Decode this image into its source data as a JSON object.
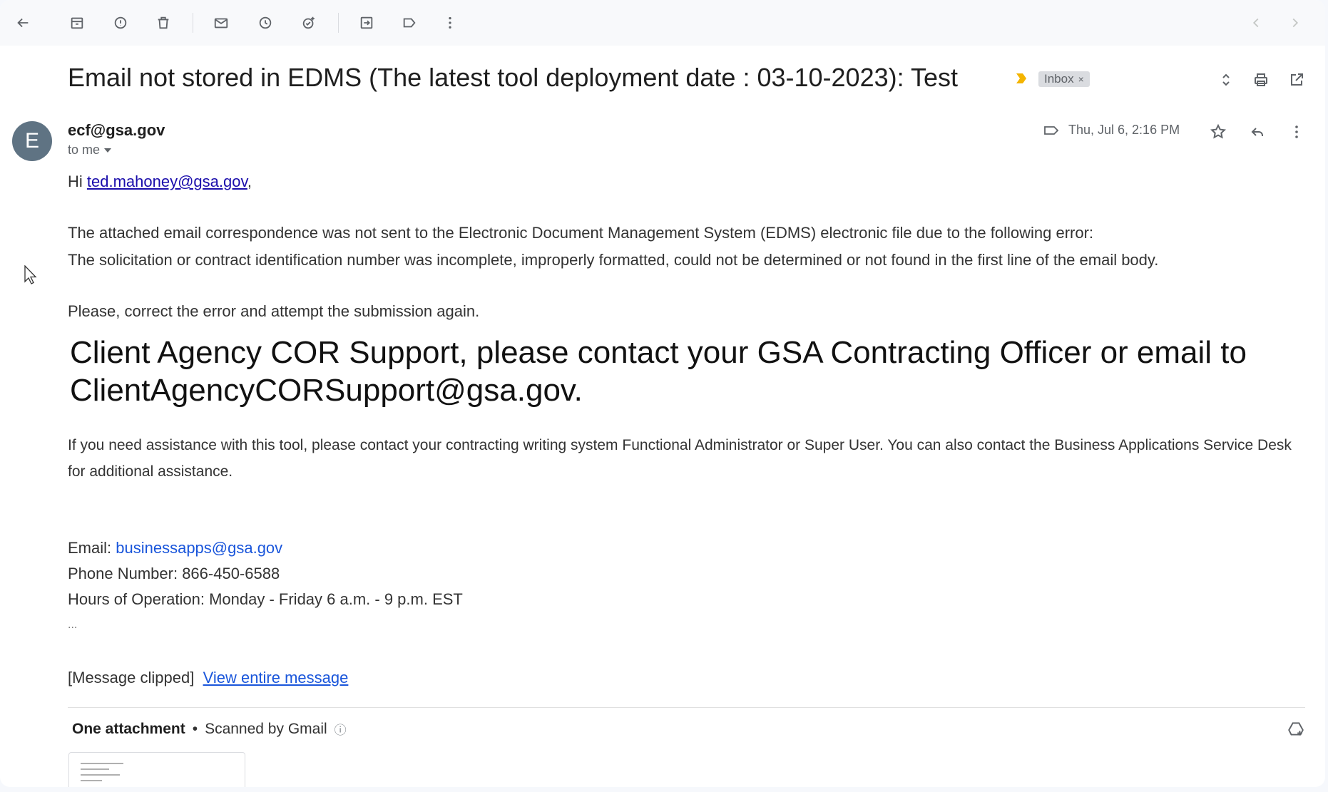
{
  "toolbar": {
    "buttons": [
      "back-icon",
      "archive-icon",
      "report-spam-icon",
      "delete-icon",
      "mark-unread-icon",
      "snooze-icon",
      "add-task-icon",
      "move-to-icon",
      "labels-icon",
      "more-icon"
    ],
    "nav": [
      "older-icon",
      "newer-icon"
    ]
  },
  "subject": {
    "text": "Email not stored in EDMS (The latest tool deployment date : 03-10-2023): Test",
    "label": "Inbox",
    "label_close": "×",
    "importance_color": "#f4b400"
  },
  "message": {
    "avatar_letter": "E",
    "avatar_color": "#5f7383",
    "sender": "ecf@gsa.gov",
    "recipient": "to me",
    "date": "Thu, Jul 6, 2:16 PM"
  },
  "body": {
    "greeting_prefix": "Hi ",
    "greeting_link": "ted.mahoney@gsa.gov",
    "greeting_suffix": ",",
    "error_line1": "The attached email correspondence was not sent to the Electronic Document Management System (EDMS) electronic file due to the following error:",
    "error_line2": "The solicitation or contract identification number was incomplete, improperly formatted, could not be determined or not found in the first line of the email body.",
    "retry_line": "Please, correct the error and attempt the submission again.",
    "notice": "Client Agency COR Support, please contact your GSA Contracting Officer or email to ClientAgencyCORSupport@gsa.gov.",
    "assist_para": "If you need assistance with this tool, please contact your contracting writing system Functional Administrator or Super User. You can also contact the Business Applications Service Desk for additional assistance.",
    "email_label": "Email: ",
    "email_link": "businessapps@gsa.gov",
    "phone": "Phone Number: 866-450-6588",
    "hours": "Hours of Operation: Monday - Friday 6 a.m. - 9 p.m. EST",
    "ellipsis": "...",
    "clipped_label": "[Message clipped]",
    "view_entire": "View entire message"
  },
  "attachments": {
    "title": "One attachment",
    "separator": "•",
    "scanned": "Scanned by Gmail",
    "info_icon": "ⓘ"
  }
}
